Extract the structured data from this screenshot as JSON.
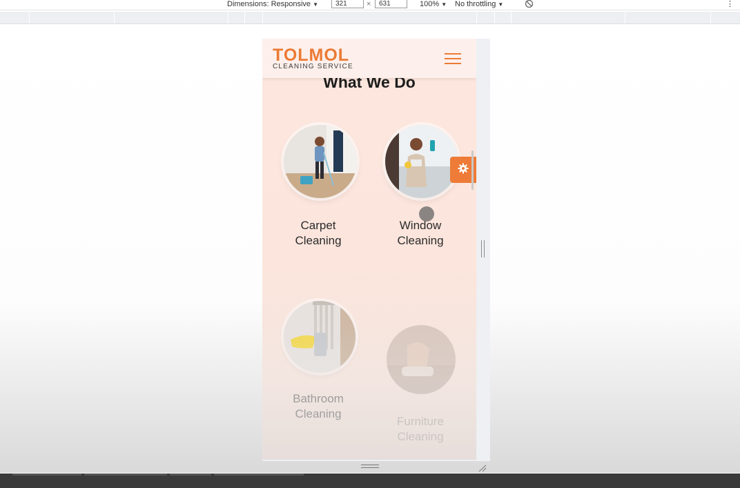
{
  "devtools": {
    "dimensions_label": "Dimensions: Responsive",
    "width_value": "321",
    "times_symbol": "×",
    "height_value": "631",
    "zoom_label": "100%",
    "throttling_label": "No throttling",
    "dropdown_caret": "▼",
    "more_menu": "⋮"
  },
  "site": {
    "logo": {
      "title": "TOLMOL",
      "subtitle": "CLEANING SERVICE"
    },
    "section_title": "What We Do",
    "services": [
      {
        "line1": "Carpet",
        "line2": "Cleaning",
        "icon": "carpet-cleaning-photo"
      },
      {
        "line1": "Window",
        "line2": "Cleaning",
        "icon": "window-cleaning-photo"
      },
      {
        "line1": "Bathroom",
        "line2": "Cleaning",
        "icon": "bathroom-cleaning-photo"
      },
      {
        "line1": "Furniture",
        "line2": "Cleaning",
        "icon": "furniture-cleaning-photo"
      }
    ]
  },
  "colors": {
    "brand_orange": "#ec7a34",
    "page_bg": "#fce6de",
    "heading": "#1d1d1d"
  }
}
